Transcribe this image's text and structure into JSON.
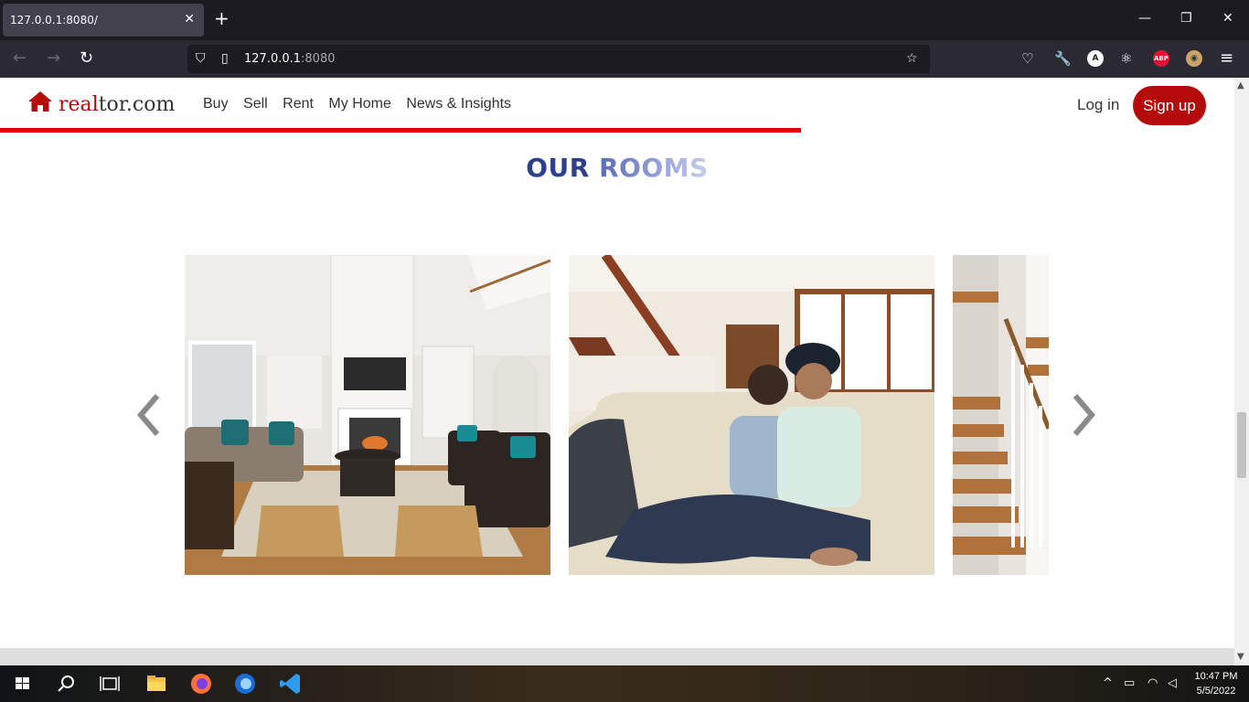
{
  "browser": {
    "tab_title": "127.0.0.1:8080/",
    "url_host": "127.0.0.1",
    "url_port": ":8080"
  },
  "site": {
    "logo_part1": "real",
    "logo_part2": "tor.com",
    "nav": [
      "Buy",
      "Sell",
      "Rent",
      "My Home",
      "News & Insights"
    ],
    "login_label": "Log in",
    "signup_label": "Sign up",
    "section_title_1": "OUR",
    "section_title_2": "ROOMS",
    "slides": [
      {
        "name": "living-room-photo"
      },
      {
        "name": "couple-on-sofa-photo"
      },
      {
        "name": "staircase-photo"
      }
    ],
    "colors": {
      "brand_red": "#b50b0b",
      "accent_line": "#e80000",
      "title_blue": "#2e3f8f"
    }
  },
  "taskbar": {
    "time": "10:47 PM",
    "date": "5/5/2022"
  }
}
